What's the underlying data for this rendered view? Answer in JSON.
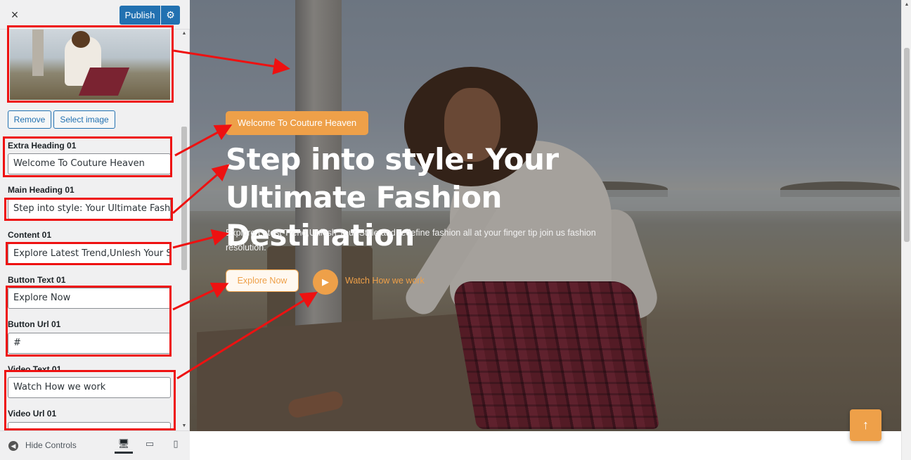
{
  "topbar": {
    "close_icon": "×",
    "publish_label": "Publish",
    "gear_icon": "⚙"
  },
  "media": {
    "remove_label": "Remove",
    "select_label": "Select image"
  },
  "fields": {
    "extra_heading": {
      "label": "Extra Heading 01",
      "value": "Welcome To Couture Heaven"
    },
    "main_heading": {
      "label": "Main Heading 01",
      "value": "Step into style: Your Ultimate Fashion"
    },
    "content": {
      "label": "Content 01",
      "value": "Explore Latest Trend,Unlesh Your Style"
    },
    "button_text": {
      "label": "Button Text 01",
      "value": "Explore Now"
    },
    "button_url": {
      "label": "Button Url 01",
      "value": "#"
    },
    "video_text": {
      "label": "Video Text 01",
      "value": "Watch How we work"
    },
    "video_url": {
      "label": "Video Url 01",
      "value": ""
    }
  },
  "bottombar": {
    "hide_label": "Hide Controls",
    "hide_icon": "◀",
    "desktop_icon": "🖥",
    "tablet_icon": "▭",
    "mobile_icon": "▯"
  },
  "hero": {
    "tagline": "Welcome To Couture Heaven",
    "headline": "Step into style: Your Ultimate Fashion Destination",
    "content": "Explore Latest Trend,Unlesh Your Style and redefine fashion all at your finger tip join us fashion resolution.",
    "explore_label": "Explore Now",
    "play_icon": "▶",
    "watch_label": "Watch How we work",
    "totop_icon": "↑"
  },
  "colors": {
    "accent": "#eea049",
    "wp_blue": "#2271b1",
    "annotation_red": "#ee1111"
  }
}
